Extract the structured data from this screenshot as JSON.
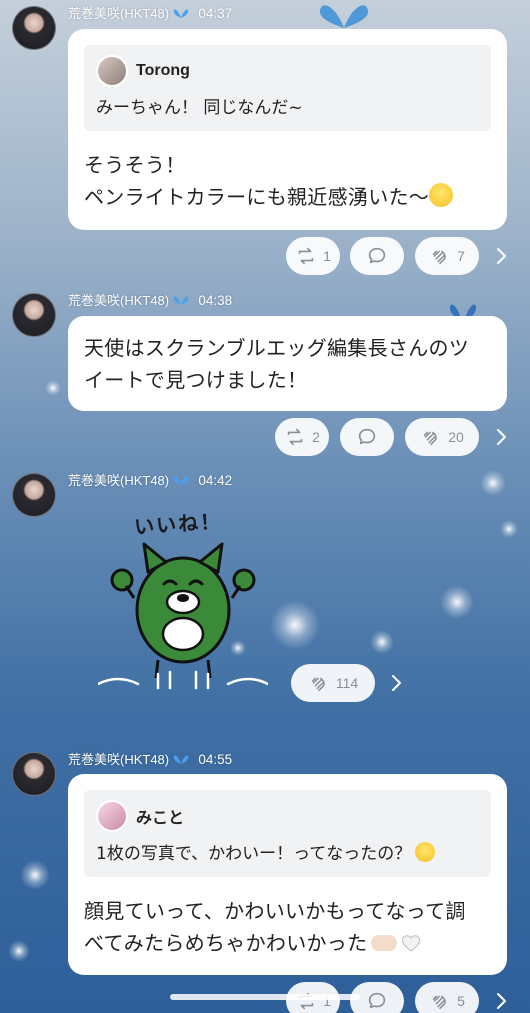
{
  "posts": [
    {
      "author": "荒巻美咲(HKT48)",
      "time": "04:37",
      "quote": {
        "name": "Torong",
        "text": "みーちゃん！ 同じなんだ~"
      },
      "text_lines": [
        "そうそう！",
        "ペンライトカラーにも親近感湧いた〜"
      ],
      "reactions": {
        "repost": "1",
        "clap": "7"
      }
    },
    {
      "author": "荒巻美咲(HKT48)",
      "time": "04:38",
      "text_lines": [
        "天使はスクランブルエッグ編集長さんのツ",
        "イートで見つけました！"
      ],
      "reactions": {
        "repost": "2",
        "clap": "20"
      }
    },
    {
      "author": "荒巻美咲(HKT48)",
      "time": "04:42",
      "sticker_text": "いいね！",
      "reactions": {
        "clap": "114"
      }
    },
    {
      "author": "荒巻美咲(HKT48)",
      "time": "04:55",
      "quote": {
        "name": "みこと",
        "text": "1枚の写真で、かわいー！ってなったの？"
      },
      "text_lines": [
        "顔見ていって、かわいいかもってなって調",
        "べてみたらめちゃかわいかった"
      ],
      "reactions": {
        "repost": "1",
        "clap": "5"
      }
    }
  ]
}
